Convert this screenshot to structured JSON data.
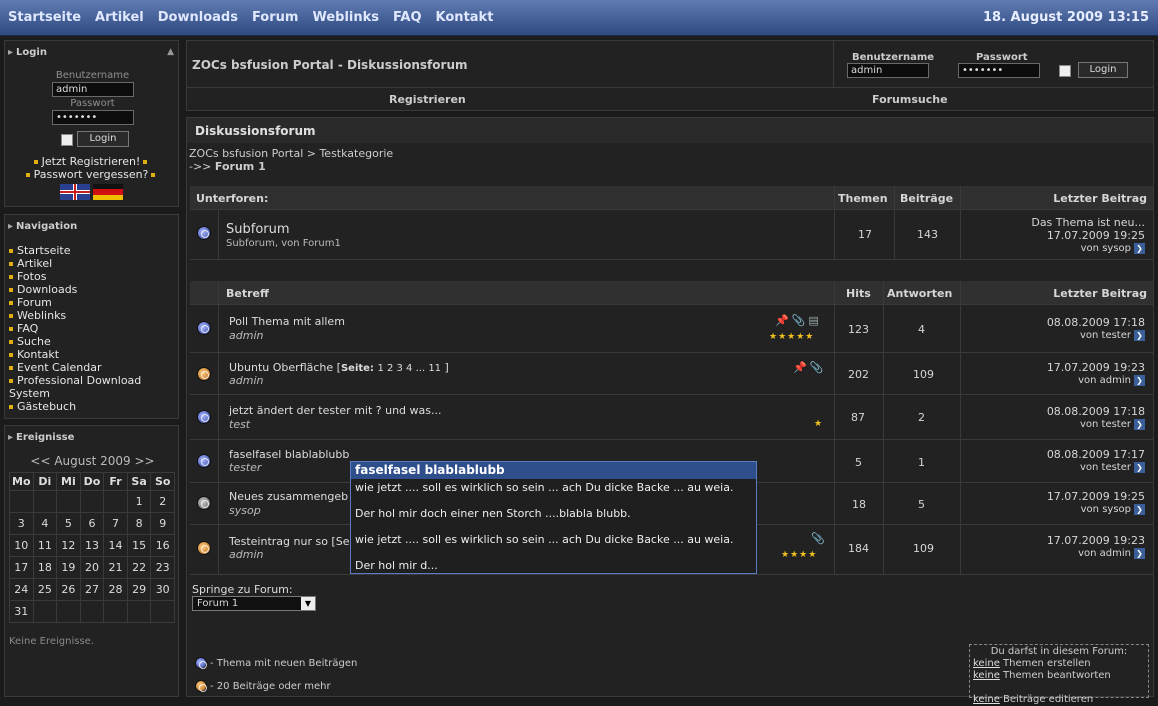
{
  "topnav": [
    "Startseite",
    "Artikel",
    "Downloads",
    "Forum",
    "Weblinks",
    "FAQ",
    "Kontakt"
  ],
  "datetime": "18. August 2009 13:15",
  "login": {
    "title": "Login",
    "user_label": "Benutzername",
    "user_value": "admin",
    "pass_label": "Passwort",
    "pass_value": "•••••••",
    "button": "Login",
    "register": "Jetzt Registrieren!",
    "forgot": "Passwort vergessen?"
  },
  "navigation": {
    "title": "Navigation",
    "items": [
      "Startseite",
      "Artikel",
      "Fotos",
      "Downloads",
      "Forum",
      "Weblinks",
      "FAQ",
      "Suche",
      "Kontakt",
      "Event Calendar",
      "Professional Download",
      "Gästebuch"
    ],
    "item_10_wrap": "System"
  },
  "events": {
    "title": "Ereignisse",
    "month": "<< August 2009 >>",
    "days": [
      "Mo",
      "Di",
      "Mi",
      "Do",
      "Fr",
      "Sa",
      "So"
    ],
    "weeks": [
      [
        "",
        "",
        "",
        "",
        "",
        "1",
        "2"
      ],
      [
        "3",
        "4",
        "5",
        "6",
        "7",
        "8",
        "9"
      ],
      [
        "10",
        "11",
        "12",
        "13",
        "14",
        "15",
        "16"
      ],
      [
        "17",
        "18",
        "19",
        "20",
        "21",
        "22",
        "23"
      ],
      [
        "24",
        "25",
        "26",
        "27",
        "28",
        "29",
        "30"
      ],
      [
        "31",
        "",
        "",
        "",
        "",
        "",
        ""
      ]
    ],
    "none": "Keine Ereignisse."
  },
  "header_panel": {
    "title": "ZOCs bsfusion Portal - Diskussionsforum",
    "user_label": "Benutzername",
    "user_value": "admin",
    "pass_label": "Passwort",
    "pass_value": "•••••••",
    "login_btn": "Login",
    "register": "Registrieren",
    "search": "Forumsuche"
  },
  "forum": {
    "title": "Diskussionsforum",
    "crumb": "ZOCs bsfusion Portal > Testkategorie",
    "crumb2_prefix": "->>",
    "crumb2": "Forum 1",
    "sub_headers": {
      "name": "Unterforen:",
      "topics": "Themen",
      "posts": "Beiträge",
      "last": "Letzter Beitrag"
    },
    "subforum": {
      "name": "Subforum",
      "desc": "Subforum, von Forum1",
      "topics": "17",
      "posts": "143",
      "last_title": "Das Thema ist neu...",
      "last_date": "17.07.2009 19:25",
      "last_by": "von sysop"
    },
    "topic_headers": {
      "subject": "Betreff",
      "hits": "Hits",
      "replies": "Antworten",
      "last": "Letzter Beitrag"
    },
    "topics": [
      {
        "title": "Poll Thema mit allem",
        "author": "admin",
        "hits": "123",
        "replies": "4",
        "date": "08.08.2009 17:18",
        "by": "von tester",
        "stars": "★★★★★"
      },
      {
        "title": "Ubuntu Oberfläche",
        "pages_label": "Seite:",
        "pages": "1 2 3 4 ... 11",
        "author": "admin",
        "hits": "202",
        "replies": "109",
        "date": "17.07.2009 19:23",
        "by": "von admin",
        "stars": ""
      },
      {
        "title": "jetzt ändert der tester mit ? und was...",
        "author": "test",
        "hits": "87",
        "replies": "2",
        "date": "08.08.2009 17:18",
        "by": "von tester",
        "stars": "★"
      },
      {
        "title": "faselfasel blablablubb",
        "author": "tester",
        "hits": "5",
        "replies": "1",
        "date": "08.08.2009 17:17",
        "by": "von tester",
        "stars": ""
      },
      {
        "title": "Neues zusammengeb",
        "author": "sysop",
        "hits": "18",
        "replies": "5",
        "date": "17.07.2009 19:25",
        "by": "von sysop",
        "stars": ""
      },
      {
        "title": "Testeintrag nur so [Se",
        "author": "admin",
        "hits": "184",
        "replies": "109",
        "date": "17.07.2009 19:23",
        "by": "von admin",
        "stars": "★★★★"
      }
    ],
    "jump_label": "Springe zu Forum:",
    "jump_value": "Forum 1",
    "legend": [
      "- Thema mit neuen Beiträgen",
      "- 20 Beiträge oder mehr"
    ],
    "perm_title": "Du darfst in diesem Forum:",
    "perm_word": "keine",
    "perms": [
      "Themen erstellen",
      "Themen beantworten",
      "Beiträge editieren"
    ]
  },
  "tooltip": {
    "title": "faselfasel blablablubb",
    "lines": [
      "wie jetzt .... soll es wirklich so sein ... ach Du dicke Backe ... au weia.",
      "Der hol mir doch einer nen Storch ....blabla blubb.",
      "wie jetzt .... soll es wirklich so sein ... ach Du dicke Backe ... au weia.",
      "Der hol mir d..."
    ]
  }
}
